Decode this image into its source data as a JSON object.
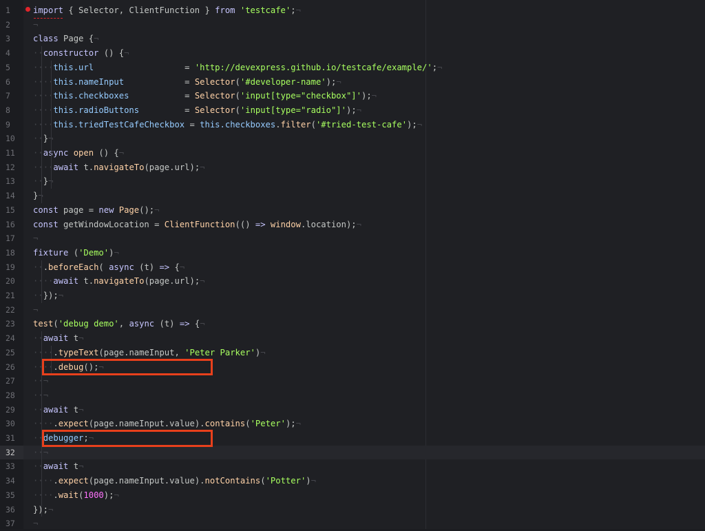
{
  "editor": {
    "language": "javascript",
    "active_line": 32,
    "lines": [
      {
        "n": "1",
        "i": 0,
        "t": [
          [
            "kw",
            "import"
          ],
          [
            "plain",
            " { Selector, ClientFunction } "
          ],
          [
            "kw",
            "from"
          ],
          [
            "plain",
            " "
          ],
          [
            "str",
            "'testcafe'"
          ],
          [
            "plain",
            ";"
          ]
        ]
      },
      {
        "n": "2",
        "i": 0,
        "t": []
      },
      {
        "n": "3",
        "i": 0,
        "t": [
          [
            "kw",
            "class"
          ],
          [
            "plain",
            " Page {"
          ]
        ]
      },
      {
        "n": "4",
        "i": 1,
        "t": [
          [
            "kw",
            "constructor"
          ],
          [
            "plain",
            " () {"
          ]
        ]
      },
      {
        "n": "5",
        "i": 2,
        "t": [
          [
            "blue",
            "this.url"
          ],
          [
            "plain",
            "                  = "
          ],
          [
            "str",
            "'http://devexpress.github.io/testcafe/example/'"
          ],
          [
            "plain",
            ";"
          ]
        ]
      },
      {
        "n": "6",
        "i": 2,
        "t": [
          [
            "blue",
            "this.nameInput"
          ],
          [
            "plain",
            "            = "
          ],
          [
            "fn",
            "Selector"
          ],
          [
            "plain",
            "("
          ],
          [
            "str",
            "'#developer-name'"
          ],
          [
            "plain",
            ");"
          ]
        ]
      },
      {
        "n": "7",
        "i": 2,
        "t": [
          [
            "blue",
            "this.checkboxes"
          ],
          [
            "plain",
            "           = "
          ],
          [
            "fn",
            "Selector"
          ],
          [
            "plain",
            "("
          ],
          [
            "str",
            "'input[type=\"checkbox\"]'"
          ],
          [
            "plain",
            ");"
          ]
        ]
      },
      {
        "n": "8",
        "i": 2,
        "t": [
          [
            "blue",
            "this.radioButtons"
          ],
          [
            "plain",
            "         = "
          ],
          [
            "fn",
            "Selector"
          ],
          [
            "plain",
            "("
          ],
          [
            "str",
            "'input[type=\"radio\"]'"
          ],
          [
            "plain",
            ");"
          ]
        ]
      },
      {
        "n": "9",
        "i": 2,
        "t": [
          [
            "blue",
            "this.triedTestCafeCheckbox"
          ],
          [
            "plain",
            " = "
          ],
          [
            "blue",
            "this.checkboxes"
          ],
          [
            "plain",
            "."
          ],
          [
            "fn",
            "filter"
          ],
          [
            "plain",
            "("
          ],
          [
            "str",
            "'#tried-test-cafe'"
          ],
          [
            "plain",
            ");"
          ]
        ]
      },
      {
        "n": "10",
        "i": 1,
        "t": [
          [
            "plain",
            "}"
          ]
        ]
      },
      {
        "n": "11",
        "i": 1,
        "t": [
          [
            "kw",
            "async"
          ],
          [
            "plain",
            " "
          ],
          [
            "fn",
            "open"
          ],
          [
            "plain",
            " () {"
          ]
        ]
      },
      {
        "n": "12",
        "i": 2,
        "t": [
          [
            "kw",
            "await"
          ],
          [
            "plain",
            " t."
          ],
          [
            "fn",
            "navigateTo"
          ],
          [
            "plain",
            "(page.url);"
          ]
        ]
      },
      {
        "n": "13",
        "i": 1,
        "t": [
          [
            "plain",
            "}"
          ]
        ]
      },
      {
        "n": "14",
        "i": 0,
        "t": [
          [
            "plain",
            "}"
          ]
        ]
      },
      {
        "n": "15",
        "i": 0,
        "t": [
          [
            "kw",
            "const"
          ],
          [
            "plain",
            " page = "
          ],
          [
            "kw",
            "new"
          ],
          [
            "plain",
            " "
          ],
          [
            "fn",
            "Page"
          ],
          [
            "plain",
            "();"
          ]
        ]
      },
      {
        "n": "16",
        "i": 0,
        "t": [
          [
            "kw",
            "const"
          ],
          [
            "plain",
            " getWindowLocation = "
          ],
          [
            "fn",
            "ClientFunction"
          ],
          [
            "plain",
            "(() "
          ],
          [
            "kw",
            "=>"
          ],
          [
            "plain",
            " "
          ],
          [
            "fn",
            "window"
          ],
          [
            "plain",
            ".location);"
          ]
        ]
      },
      {
        "n": "17",
        "i": 0,
        "t": []
      },
      {
        "n": "18",
        "i": 0,
        "t": [
          [
            "kw",
            "fixture"
          ],
          [
            "plain",
            " ("
          ],
          [
            "str",
            "'Demo'"
          ],
          [
            "plain",
            ")"
          ]
        ]
      },
      {
        "n": "19",
        "i": 1,
        "t": [
          [
            "plain",
            "."
          ],
          [
            "fn",
            "beforeEach"
          ],
          [
            "plain",
            "( "
          ],
          [
            "kw",
            "async"
          ],
          [
            "plain",
            " (t) "
          ],
          [
            "kw",
            "=>"
          ],
          [
            "plain",
            " {"
          ]
        ]
      },
      {
        "n": "20",
        "i": 2,
        "t": [
          [
            "kw",
            "await"
          ],
          [
            "plain",
            " t."
          ],
          [
            "fn",
            "navigateTo"
          ],
          [
            "plain",
            "(page.url);"
          ]
        ]
      },
      {
        "n": "21",
        "i": 1,
        "t": [
          [
            "plain",
            "});"
          ]
        ]
      },
      {
        "n": "22",
        "i": 0,
        "t": []
      },
      {
        "n": "23",
        "i": 0,
        "t": [
          [
            "fn",
            "test"
          ],
          [
            "plain",
            "("
          ],
          [
            "str",
            "'debug demo'"
          ],
          [
            "plain",
            ", "
          ],
          [
            "kw",
            "async"
          ],
          [
            "plain",
            " (t) "
          ],
          [
            "kw",
            "=>"
          ],
          [
            "plain",
            " {"
          ]
        ]
      },
      {
        "n": "24",
        "i": 1,
        "t": [
          [
            "kw",
            "await"
          ],
          [
            "plain",
            " t"
          ]
        ]
      },
      {
        "n": "25",
        "i": 2,
        "t": [
          [
            "plain",
            "."
          ],
          [
            "fn",
            "typeText"
          ],
          [
            "plain",
            "(page.nameInput, "
          ],
          [
            "str",
            "'Peter Parker'"
          ],
          [
            "plain",
            ")"
          ]
        ]
      },
      {
        "n": "26",
        "i": 2,
        "t": [
          [
            "plain",
            "."
          ],
          [
            "fn",
            "debug"
          ],
          [
            "plain",
            "();"
          ]
        ]
      },
      {
        "n": "27",
        "i": 1,
        "t": []
      },
      {
        "n": "28",
        "i": 1,
        "t": []
      },
      {
        "n": "29",
        "i": 1,
        "t": [
          [
            "kw",
            "await"
          ],
          [
            "plain",
            " t"
          ]
        ]
      },
      {
        "n": "30",
        "i": 2,
        "t": [
          [
            "plain",
            "."
          ],
          [
            "fn",
            "expect"
          ],
          [
            "plain",
            "(page.nameInput.value)."
          ],
          [
            "fn",
            "contains"
          ],
          [
            "plain",
            "("
          ],
          [
            "str",
            "'Peter'"
          ],
          [
            "plain",
            ");"
          ]
        ]
      },
      {
        "n": "31",
        "i": 1,
        "t": [
          [
            "blue",
            "debugger"
          ],
          [
            "plain",
            ";"
          ]
        ]
      },
      {
        "n": "32",
        "i": 1,
        "t": []
      },
      {
        "n": "33",
        "i": 1,
        "t": [
          [
            "kw",
            "await"
          ],
          [
            "plain",
            " t"
          ]
        ]
      },
      {
        "n": "34",
        "i": 2,
        "t": [
          [
            "plain",
            "."
          ],
          [
            "fn",
            "expect"
          ],
          [
            "plain",
            "(page.nameInput.value)."
          ],
          [
            "fn",
            "notContains"
          ],
          [
            "plain",
            "("
          ],
          [
            "str",
            "'Potter'"
          ],
          [
            "plain",
            ")"
          ]
        ]
      },
      {
        "n": "35",
        "i": 2,
        "t": [
          [
            "plain",
            "."
          ],
          [
            "fn",
            "wait"
          ],
          [
            "plain",
            "("
          ],
          [
            "num-lit",
            "1000"
          ],
          [
            "plain",
            ");"
          ]
        ]
      },
      {
        "n": "36",
        "i": 0,
        "t": [
          [
            "plain",
            "});"
          ]
        ]
      },
      {
        "n": "37",
        "i": 0,
        "t": []
      }
    ]
  },
  "annotations": {
    "highlight_color": "#e8401c",
    "boxes_around_lines": [
      26,
      31
    ]
  },
  "colors": {
    "background": "#1f2024",
    "keyword": "#c6c5fe",
    "string": "#a8ff60",
    "function": "#ffd2a7",
    "this_ref": "#96cbfe",
    "number": "#ff73fd"
  }
}
